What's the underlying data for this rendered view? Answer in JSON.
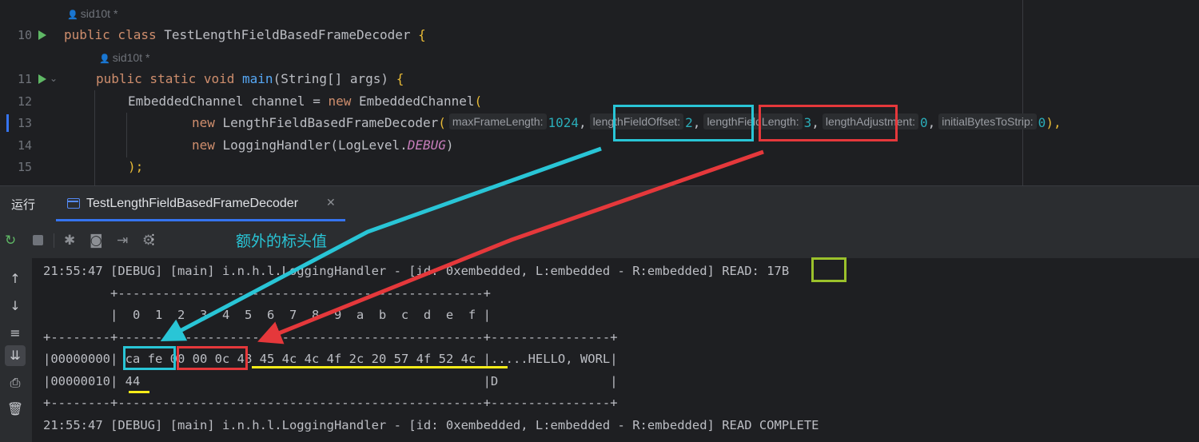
{
  "editor": {
    "author": "sid10t *",
    "lines": {
      "l10": {
        "num": "10",
        "kw": "public class ",
        "name": "TestLengthFieldBasedFrameDecoder",
        "tail": " {"
      },
      "l11": {
        "num": "11",
        "kw": "public static void ",
        "name": "main",
        "args": "(String[] args) ",
        "brace": "{"
      },
      "l12": {
        "num": "12",
        "text": "EmbeddedChannel channel = ",
        "kw": "new ",
        "ctor": "EmbeddedChannel",
        "paren": "("
      },
      "l13": {
        "num": "13",
        "kw": "new ",
        "ctor": "LengthFieldBasedFrameDecoder",
        "paren": "(",
        "params": [
          {
            "hint": "maxFrameLength:",
            "value": "1024",
            "sep": ","
          },
          {
            "hint": "lengthFieldOffset:",
            "value": "2",
            "sep": ","
          },
          {
            "hint": "lengthFieldLength:",
            "value": "3",
            "sep": ","
          },
          {
            "hint": "lengthAdjustment:",
            "value": "0",
            "sep": ","
          },
          {
            "hint": "initialBytesToStrip:",
            "value": "0",
            "sep": "),"
          }
        ]
      },
      "l14": {
        "num": "14",
        "kw": "new ",
        "ctor": "LoggingHandler",
        "open": "(LogLevel.",
        "constant": "DEBUG",
        "close": ")"
      },
      "l15": {
        "num": "15",
        "text": ");"
      }
    }
  },
  "run_window": {
    "title": "运行",
    "tab_label": "TestLengthFieldBasedFrameDecoder",
    "toolbar_icons": [
      "rerun-icon",
      "stop-icon",
      "debug-icon",
      "camera-icon",
      "exit-icon",
      "settings-icon",
      "more-icon"
    ],
    "side_icons": [
      "up-arrow-icon",
      "down-arrow-icon",
      "soft-wrap-icon",
      "scroll-to-end-icon",
      "print-icon",
      "trash-icon"
    ]
  },
  "annotation": {
    "label": "额外的标头值",
    "colors": {
      "cyan": "#29c5d6",
      "red": "#e5383b",
      "yellow": "#f7ec19",
      "green": "#9bc12b"
    }
  },
  "console": {
    "read_line_prefix": "21:55:47 [DEBUG] [main] i.n.h.l.LoggingHandler - [id: 0xembedded, L:embedded - R:embedded] READ: ",
    "read_size": "17B",
    "hex_border_top": "         +-------------------------------------------------+",
    "hex_header": "         |  0  1  2  3  4  5  6  7  8  9  a  b  c  d  e  f |",
    "hex_border": "+--------+-------------------------------------------------+----------------+",
    "row1": {
      "offset": "|00000000|",
      "extra_header": " ca fe",
      "length_field": " 00 00 0c",
      "body": " 48 45 4c 4c 4f 2c 20 57 4f 52 4c",
      "ascii": " |.....HELLO, WORL|"
    },
    "row2": {
      "offset": "|00000010|",
      "body": " 44",
      "pad": "                                              ",
      "ascii": "|D               |"
    },
    "complete_line": "21:55:47 [DEBUG] [main] i.n.h.l.LoggingHandler - [id: 0xembedded, L:embedded - R:embedded] READ COMPLETE"
  }
}
